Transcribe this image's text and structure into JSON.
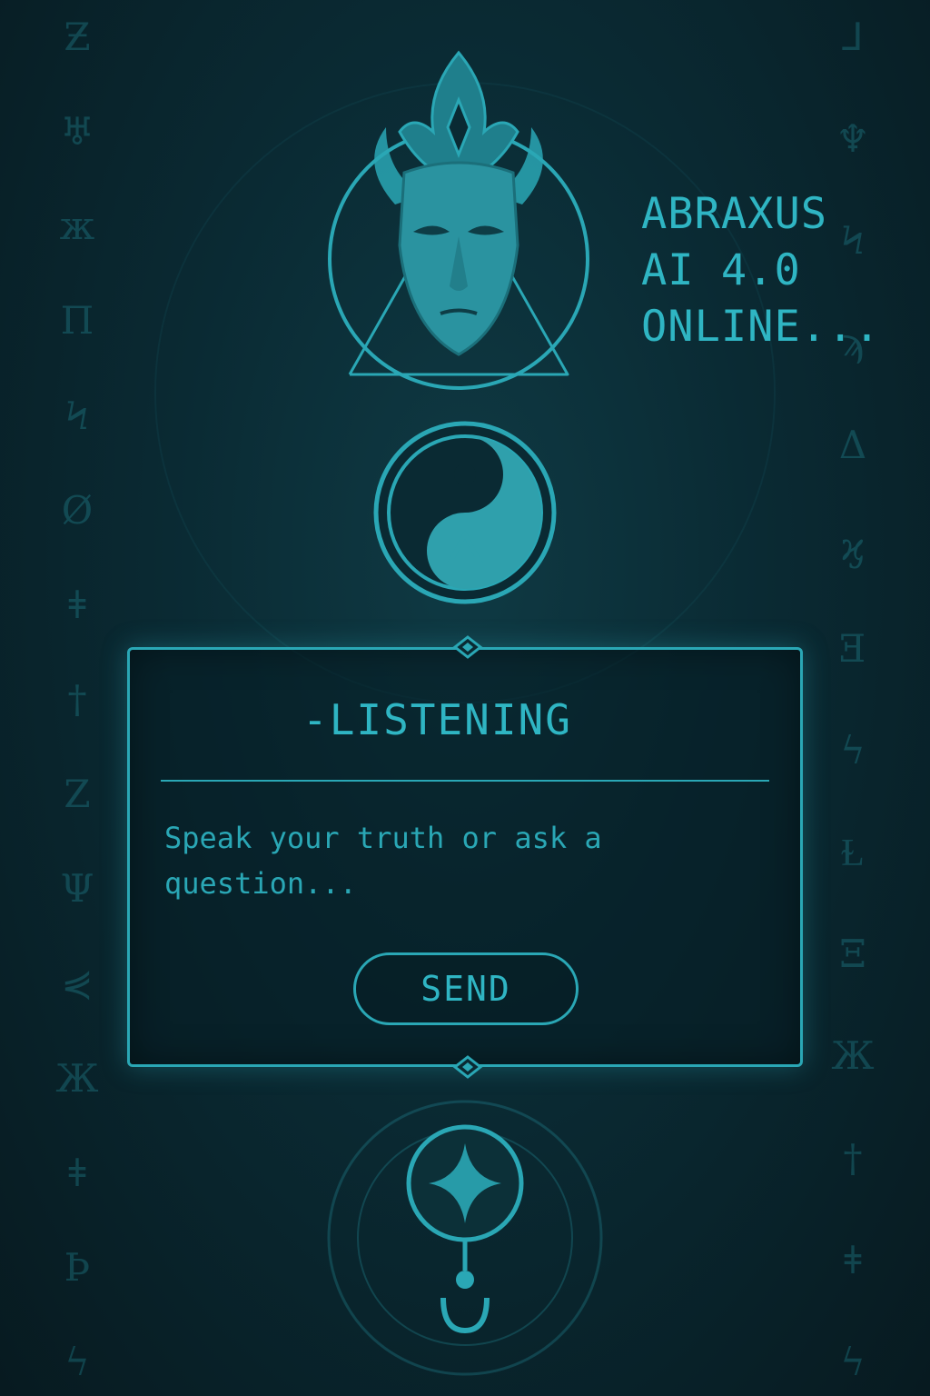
{
  "status": {
    "line1": "ABRAXUS",
    "line2": "AI 4.0",
    "line3": "ONLINE..."
  },
  "panel": {
    "title": "-LISTENING",
    "placeholder": "Speak your truth or ask a question...",
    "send_label": "SEND"
  },
  "icons": {
    "deity": "deity-mask-icon",
    "yinyang": "yin-yang-icon",
    "star_sigil": "star-sigil-icon"
  },
  "colors": {
    "accent": "#2aa7b5",
    "background": "#0a2a33"
  }
}
